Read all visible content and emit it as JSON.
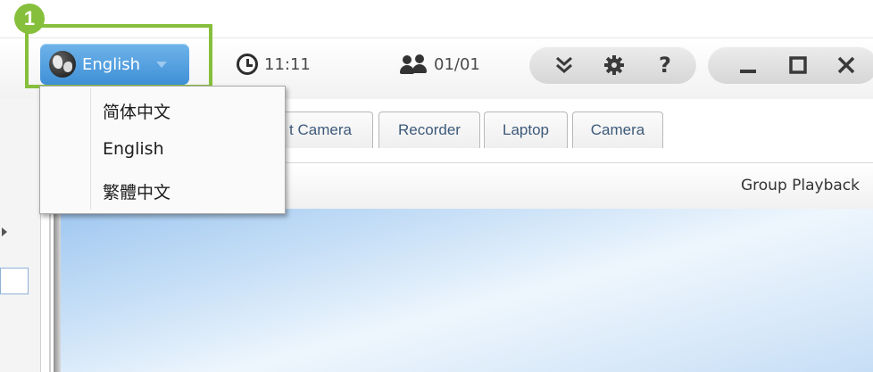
{
  "step_badge": "1",
  "toolbar": {
    "language_label": "English",
    "time": "11:11",
    "user_count": "01/01",
    "icons": {
      "language": "globe-icon",
      "time": "clock-icon",
      "users": "users-icon",
      "expand": "double-chevron-down-icon",
      "settings": "gear-icon",
      "help": "question-icon",
      "minimize": "minimize-icon",
      "maximize": "maximize-icon",
      "close": "close-icon"
    }
  },
  "language_menu": {
    "items": [
      "简体中文",
      "English",
      "繁體中文"
    ]
  },
  "tabs": [
    {
      "label": "t Camera"
    },
    {
      "label": "Recorder"
    },
    {
      "label": "Laptop"
    },
    {
      "label": "Camera"
    }
  ],
  "header": {
    "group_playback_label": "Group Playback"
  },
  "colors": {
    "highlight": "#86bf3b",
    "button_blue": "#3f8fd6"
  }
}
